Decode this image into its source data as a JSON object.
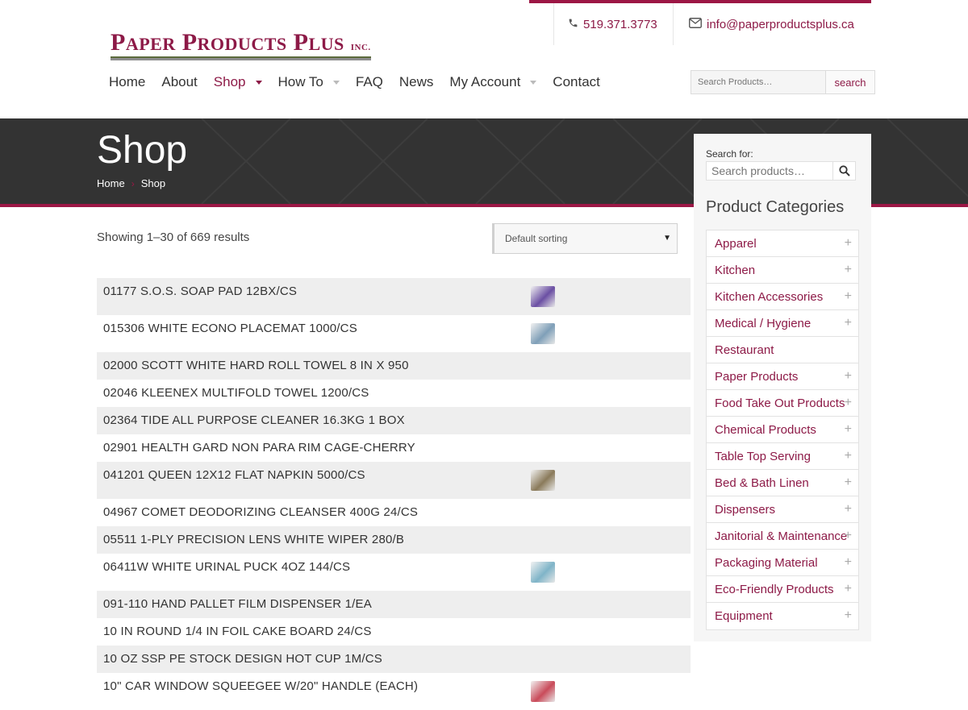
{
  "header": {
    "phone": "519.371.3773",
    "email": "info@paperproductsplus.ca",
    "logo": {
      "w1": "P",
      "w1b": "APER",
      "w2": "P",
      "w2b": "RODUCTS",
      "w3": "P",
      "w3b": "LUS",
      "inc": "INC."
    },
    "nav": [
      {
        "label": "Home",
        "dropdown": false
      },
      {
        "label": "About",
        "dropdown": false
      },
      {
        "label": "Shop",
        "dropdown": true,
        "active": true
      },
      {
        "label": "How To",
        "dropdown": true
      },
      {
        "label": "FAQ",
        "dropdown": false
      },
      {
        "label": "News",
        "dropdown": false
      },
      {
        "label": "My Account",
        "dropdown": true
      },
      {
        "label": "Contact",
        "dropdown": false
      }
    ],
    "search": {
      "placeholder": "Search Products…",
      "button": "search"
    }
  },
  "hero": {
    "title": "Shop",
    "breadcrumb": [
      "Home",
      "Shop"
    ]
  },
  "results": {
    "count_text": "Showing 1–30 of 669 results",
    "sort_selected": "Default sorting"
  },
  "products": [
    {
      "name": "01177 S.O.S. SOAP PAD 12BX/CS",
      "thumb": true,
      "thumb_color": "#6b4fa3"
    },
    {
      "name": "015306 WHITE ECONO PLACEMAT 1000/CS",
      "thumb": true,
      "thumb_color": "#7f9fb8"
    },
    {
      "name": "02000 SCOTT WHITE HARD ROLL TOWEL 8 IN X 950",
      "thumb": false
    },
    {
      "name": "02046 KLEENEX MULTIFOLD TOWEL 1200/CS",
      "thumb": false
    },
    {
      "name": "02364 TIDE ALL PURPOSE CLEANER 16.3KG 1 BOX",
      "thumb": false
    },
    {
      "name": "02901 HEALTH GARD NON PARA RIM CAGE-CHERRY",
      "thumb": false
    },
    {
      "name": "041201 QUEEN 12X12 FLAT NAPKIN 5000/CS",
      "thumb": true,
      "thumb_color": "#8a7a5a"
    },
    {
      "name": "04967 COMET DEODORIZING CLEANSER 400G 24/CS",
      "thumb": false
    },
    {
      "name": "05511 1-PLY PRECISION LENS WHITE WIPER 280/B",
      "thumb": false
    },
    {
      "name": "06411W WHITE URINAL PUCK 4OZ 144/CS",
      "thumb": true,
      "thumb_color": "#7fb4c8"
    },
    {
      "name": "091-110 HAND PALLET FILM DISPENSER 1/EA",
      "thumb": false
    },
    {
      "name": "10 IN ROUND 1/4 IN FOIL CAKE BOARD 24/CS",
      "thumb": false
    },
    {
      "name": "10 OZ SSP PE STOCK DESIGN HOT CUP 1M/CS",
      "thumb": false
    },
    {
      "name": "10\" CAR WINDOW SQUEEGEE W/20\" HANDLE (EACH)",
      "thumb": true,
      "thumb_color": "#c94b5a"
    }
  ],
  "sidebar": {
    "search_label": "Search for:",
    "search_placeholder": "Search products…",
    "categories_title": "Product Categories",
    "categories": [
      {
        "label": "Apparel",
        "expandable": true
      },
      {
        "label": "Kitchen",
        "expandable": true
      },
      {
        "label": "Kitchen Accessories",
        "expandable": true
      },
      {
        "label": "Medical / Hygiene",
        "expandable": true
      },
      {
        "label": "Restaurant",
        "expandable": false
      },
      {
        "label": "Paper Products",
        "expandable": true
      },
      {
        "label": "Food Take Out Products",
        "expandable": true
      },
      {
        "label": "Chemical Products",
        "expandable": true
      },
      {
        "label": "Table Top Serving",
        "expandable": true
      },
      {
        "label": "Bed & Bath Linen",
        "expandable": true
      },
      {
        "label": "Dispensers",
        "expandable": true
      },
      {
        "label": "Janitorial & Maintenance",
        "expandable": true
      },
      {
        "label": "Packaging Material",
        "expandable": true
      },
      {
        "label": "Eco-Friendly Products",
        "expandable": true
      },
      {
        "label": "Equipment",
        "expandable": true
      }
    ]
  },
  "colors": {
    "brand": "#8d1a47",
    "accent": "#9c1745",
    "hero_bg": "#333333"
  },
  "icons": {
    "phone": "phone-icon",
    "email": "envelope-icon",
    "search": "search-icon",
    "expand": "plus-icon"
  }
}
